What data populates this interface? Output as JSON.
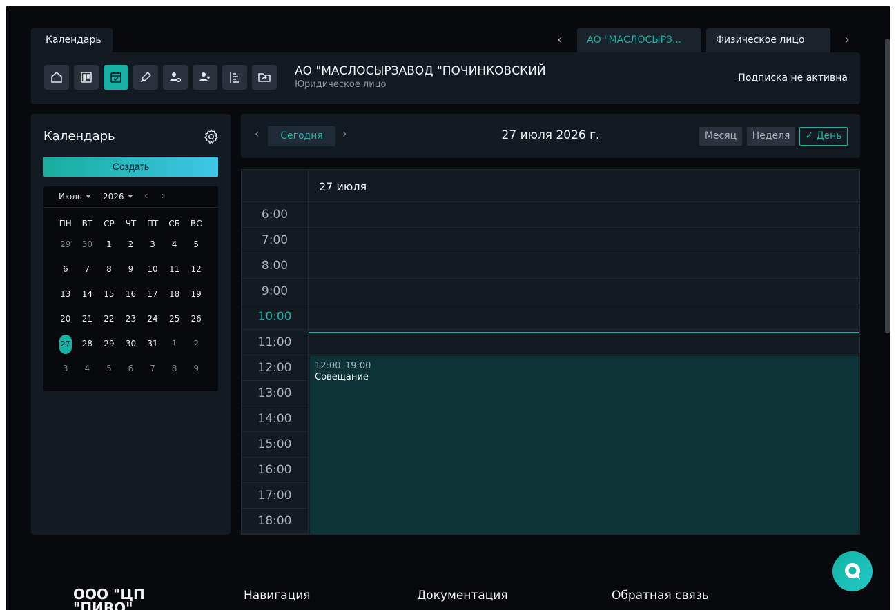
{
  "tabs": {
    "calendar_tab": "Календарь",
    "client_tabs": [
      "АО \"МАСЛОСЫРЗ...",
      "Физическое лицо"
    ]
  },
  "toolbar": {
    "icons": [
      "home-icon",
      "kanban-icon",
      "calendar-check-icon",
      "pen-icon",
      "user-settings-icon",
      "user-heart-icon",
      "tree-list-icon",
      "folder-share-icon"
    ],
    "active_icon": "calendar-check-icon",
    "org_name": "АО \"МАСЛОСЫРЗАВОД \"ПОЧИНКОВСКИЙ",
    "org_type": "Юридическое лицо",
    "subscription_status": "Подписка не активна"
  },
  "sidebar": {
    "title": "Календарь",
    "create_label": "Создать",
    "mini_calendar": {
      "month": "Июль",
      "year": "2026",
      "weekdays": [
        "ПН",
        "ВТ",
        "СР",
        "ЧТ",
        "ПТ",
        "СБ",
        "ВС"
      ],
      "weeks": [
        [
          "29",
          "30",
          "1",
          "2",
          "3",
          "4",
          "5"
        ],
        [
          "6",
          "7",
          "8",
          "9",
          "10",
          "11",
          "12"
        ],
        [
          "13",
          "14",
          "15",
          "16",
          "17",
          "18",
          "19"
        ],
        [
          "20",
          "21",
          "22",
          "23",
          "24",
          "25",
          "26"
        ],
        [
          "27",
          "28",
          "29",
          "30",
          "31",
          "1",
          "2"
        ],
        [
          "3",
          "4",
          "5",
          "6",
          "7",
          "8",
          "9"
        ]
      ],
      "selected_day": "27"
    }
  },
  "calendar_header": {
    "today_label": "Сегодня",
    "current_date": "27 июля 2026 г.",
    "views": [
      "Месяц",
      "Неделя",
      "День"
    ],
    "active_view": "День"
  },
  "day_view": {
    "day_label": "27 июля",
    "hours": [
      "6:00",
      "7:00",
      "8:00",
      "9:00",
      "10:00",
      "11:00",
      "12:00",
      "13:00",
      "14:00",
      "15:00",
      "16:00",
      "17:00",
      "18:00"
    ],
    "current_hour": "10:00",
    "event": {
      "time": "12:00–19:00",
      "title": "Совещание"
    }
  },
  "footer": {
    "company": "ООО \"ЦП \"ПИВО\"",
    "columns": [
      "Навигация",
      "Документация",
      "Обратная связь"
    ]
  },
  "colors": {
    "accent": "#16b0a5",
    "background": "#07090c",
    "panel": "#121a22",
    "event_bg": "#0c3336"
  }
}
